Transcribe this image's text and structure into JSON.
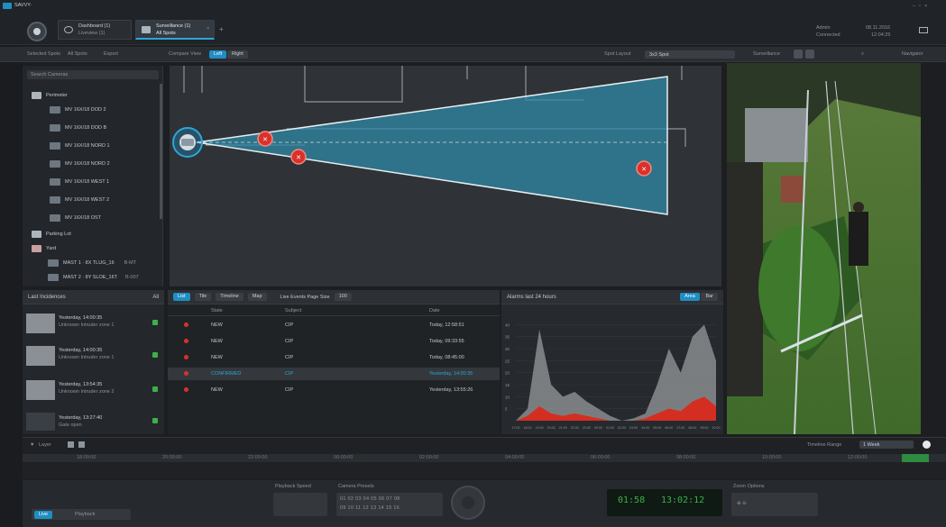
{
  "app": {
    "logo_text": "SAVVY·"
  },
  "tabs": [
    {
      "title": "Dashboard (1)",
      "subtitle": "Liveview (1)"
    },
    {
      "title": "Surveillance (1)",
      "subtitle": "All Spots"
    }
  ],
  "status": {
    "user": "Admin",
    "state": "Connected",
    "date": "08.11.2016",
    "time": "12:04:25"
  },
  "toolbar": {
    "left_items": [
      "Selected Spots",
      "All Spots",
      "Export",
      "Compare View"
    ],
    "view_options": [
      "Left",
      "Right"
    ],
    "spot_layout_label": "Spot Layout",
    "spot_layout_value": "3x3 Spot",
    "surveillance_label": "Surveillance",
    "navigator_label": "Navigator"
  },
  "tree": {
    "search_placeholder": "Search Cameras",
    "groups": [
      {
        "label": "Perimeter",
        "items": [
          "MV 16X/18 DOD 2",
          "MV 16X/18 DOD B",
          "MV 16X/18 NORD 1",
          "MV 16X/18 NORD 2",
          "MV 16X/18 WEST 1",
          "MV 16X/18 WEST 2",
          "MV 16X/18 OST"
        ]
      },
      {
        "label": "Parking Lot",
        "items": []
      },
      {
        "label": "Yard",
        "items": [
          "MAST 1 · 8X TLUG_16",
          "MAST 2 · 8Y SLOE_16T"
        ]
      }
    ],
    "item_values": [
      "B-MT",
      "B-007"
    ]
  },
  "events": {
    "title": "Last Incidences",
    "count": "All",
    "items": [
      {
        "time": "Yesterday, 14:00:35",
        "desc": "Unknown Intruder zone 1"
      },
      {
        "time": "Yesterday, 14:00:35",
        "desc": "Unknown Intruder zone 1"
      },
      {
        "time": "Yesterday, 13:54:35",
        "desc": "Unknown Intruder zone 2"
      },
      {
        "time": "Yesterday, 13:27:40",
        "desc": "Gate open"
      }
    ]
  },
  "list": {
    "header_tabs": [
      "List",
      "Tile",
      "Timeline",
      "Map"
    ],
    "rows_label": "Live Events Page Size",
    "rows_value": "100",
    "columns": [
      "State",
      "Subject",
      "Date"
    ],
    "rows": [
      {
        "state": "NEW",
        "subject": "CIP",
        "date": "Today, 12:58:51"
      },
      {
        "state": "NEW",
        "subject": "CIP",
        "date": "Today, 09:33:55"
      },
      {
        "state": "NEW",
        "subject": "CIP",
        "date": "Today, 08:45:00"
      },
      {
        "state": "CONFIRMED",
        "subject": "CIP",
        "date": "Yesterday, 14:00:35"
      },
      {
        "state": "NEW",
        "subject": "CIP",
        "date": "Yesterday, 13:55:26"
      }
    ]
  },
  "chart": {
    "title": "Alarms last 24 hours",
    "toggle_labels": [
      "Area",
      "Bar"
    ],
    "ylabels": [
      "40",
      "35",
      "30",
      "25",
      "20",
      "15",
      "10",
      "5"
    ],
    "xlabels": [
      "17:00",
      "18:00",
      "19:00",
      "20:00",
      "21:00",
      "22:00",
      "23:00",
      "00:00",
      "01:00",
      "02:00",
      "03:00",
      "04:00",
      "05:00",
      "06:00",
      "07:00",
      "08:00",
      "09:00",
      "10:00"
    ]
  },
  "chart_data": {
    "type": "area",
    "title": "Alarms last 24 hours",
    "x": [
      "17:00",
      "18:00",
      "19:00",
      "20:00",
      "21:00",
      "22:00",
      "23:00",
      "00:00",
      "01:00",
      "02:00",
      "03:00",
      "04:00",
      "05:00",
      "06:00",
      "07:00",
      "08:00",
      "09:00",
      "10:00"
    ],
    "series": [
      {
        "name": "Area",
        "values": [
          0,
          5,
          38,
          15,
          10,
          12,
          8,
          5,
          2,
          0,
          1,
          3,
          15,
          30,
          20,
          35,
          40,
          25
        ]
      },
      {
        "name": "Bar",
        "values": [
          0,
          2,
          6,
          3,
          2,
          3,
          2,
          1,
          0,
          0,
          0,
          1,
          3,
          5,
          4,
          8,
          10,
          6
        ]
      }
    ],
    "ylim": [
      0,
      45
    ],
    "colors": {
      "Area": "#8a8c8e",
      "Bar": "#d92a1e"
    }
  },
  "timeline": {
    "label": "Layer",
    "range_label": "Timeline Range",
    "range_value": "1 Week",
    "ticks": [
      "18:00:00",
      "20:00:00",
      "22:00:00",
      "00:00:00",
      "02:00:00",
      "04:00:00",
      "06:00:00",
      "08:00:00",
      "10:00:00",
      "12:00:00"
    ]
  },
  "bottom": {
    "live_label": "Live",
    "playback_label": "Playback",
    "speed_label": "Playback Speed",
    "controls_label": "Camera Presets",
    "preset_rows": [
      "01 02 03 04 05 06 07 08",
      "09 10 11 12 13 14 15 16"
    ],
    "lcd_left": "01:58",
    "lcd_right": "13:02:12",
    "zoom_label": "Zoom Options"
  },
  "colors": {
    "accent": "#1f8ec2",
    "alarm": "#d9322b",
    "ok": "#3bb14a"
  }
}
